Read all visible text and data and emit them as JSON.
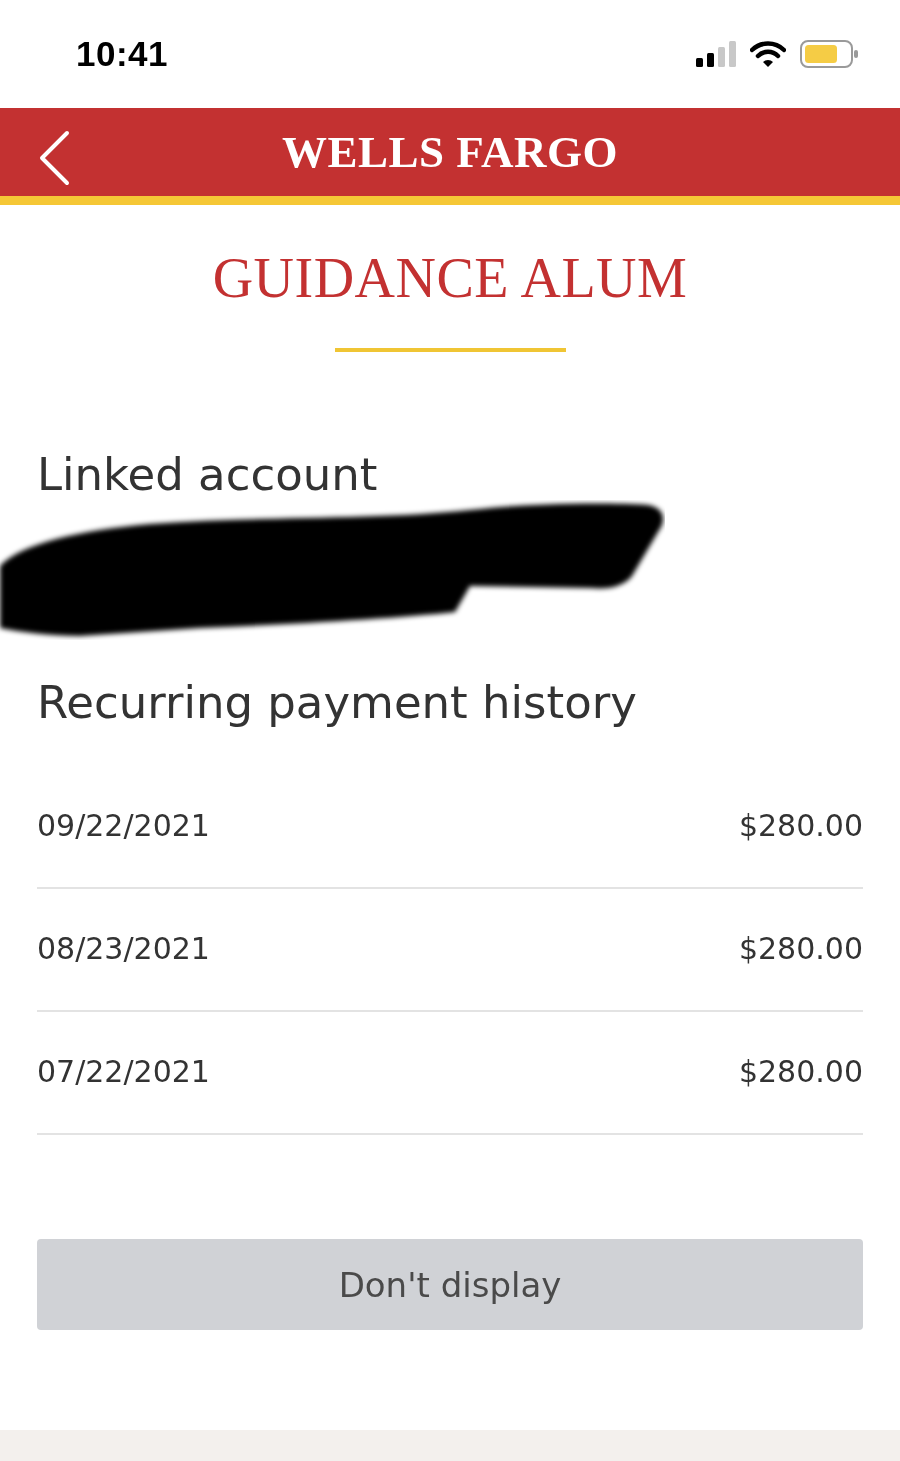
{
  "status_bar": {
    "time": "10:41"
  },
  "header": {
    "logo": "WELLS FARGO"
  },
  "page_title": "GUIDANCE ALUM",
  "linked_account": {
    "heading": "Linked account",
    "redacted": true
  },
  "history": {
    "heading": "Recurring payment history",
    "payments": [
      {
        "date": "09/22/2021",
        "amount": "$280.00"
      },
      {
        "date": "08/23/2021",
        "amount": "$280.00"
      },
      {
        "date": "07/22/2021",
        "amount": "$280.00"
      }
    ]
  },
  "button": {
    "label": "Don't display"
  }
}
